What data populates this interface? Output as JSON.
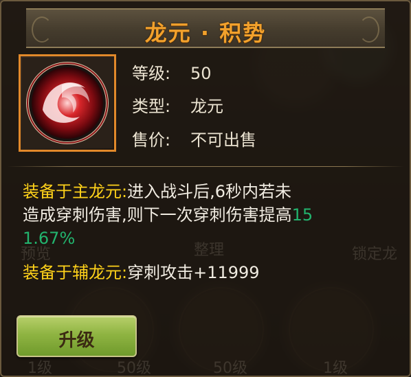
{
  "title": "龙元 · 积势",
  "item": {
    "icon": "red-swirl-dragon-orb-icon",
    "level_label": "等级:",
    "level_value": "50",
    "type_label": "类型:",
    "type_value": "龙元",
    "price_label": "售价:",
    "price_value": "不可出售"
  },
  "description": {
    "main_label": "装备于主龙元:",
    "main_text_1": "进入战斗后,6秒内若未",
    "main_text_2": "造成穿刺伤害,则下一次穿刺伤害提高",
    "main_highlight_1": "15",
    "main_highlight_2": "1.67%",
    "aux_label": "装备于辅龙元:",
    "aux_text": "穿刺攻击+11999"
  },
  "background": {
    "ghost_labels": [
      "预览",
      "整理",
      "锁定龙"
    ],
    "ghost_levels": [
      "1级",
      "50级",
      "50级",
      "1级"
    ]
  },
  "button": {
    "upgrade_label": "升级"
  },
  "colors": {
    "title": "#f2a12c",
    "label_gold": "#ffd21a",
    "highlight_green": "#22b46e",
    "icon_border": "#e2892a",
    "button": "#8fb442"
  }
}
